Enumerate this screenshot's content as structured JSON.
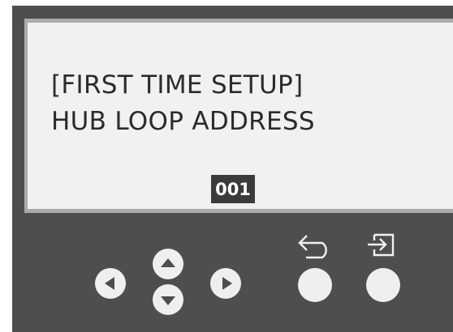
{
  "display": {
    "line1": "[FIRST TIME SETUP]",
    "line2": "HUB LOOP ADDRESS",
    "value": "001"
  },
  "buttons": {
    "left": "left-arrow-icon",
    "up": "up-arrow-icon",
    "down": "down-arrow-icon",
    "right": "right-arrow-icon",
    "back": "back-arrow-icon",
    "enter": "enter-icon"
  },
  "colors": {
    "panel": "#4e4e4e",
    "screen": "#f1f1f1",
    "bezel": "#ababab",
    "text": "#2b2b2b",
    "value_highlight": "#3b3b3b",
    "button": "#efefef"
  }
}
